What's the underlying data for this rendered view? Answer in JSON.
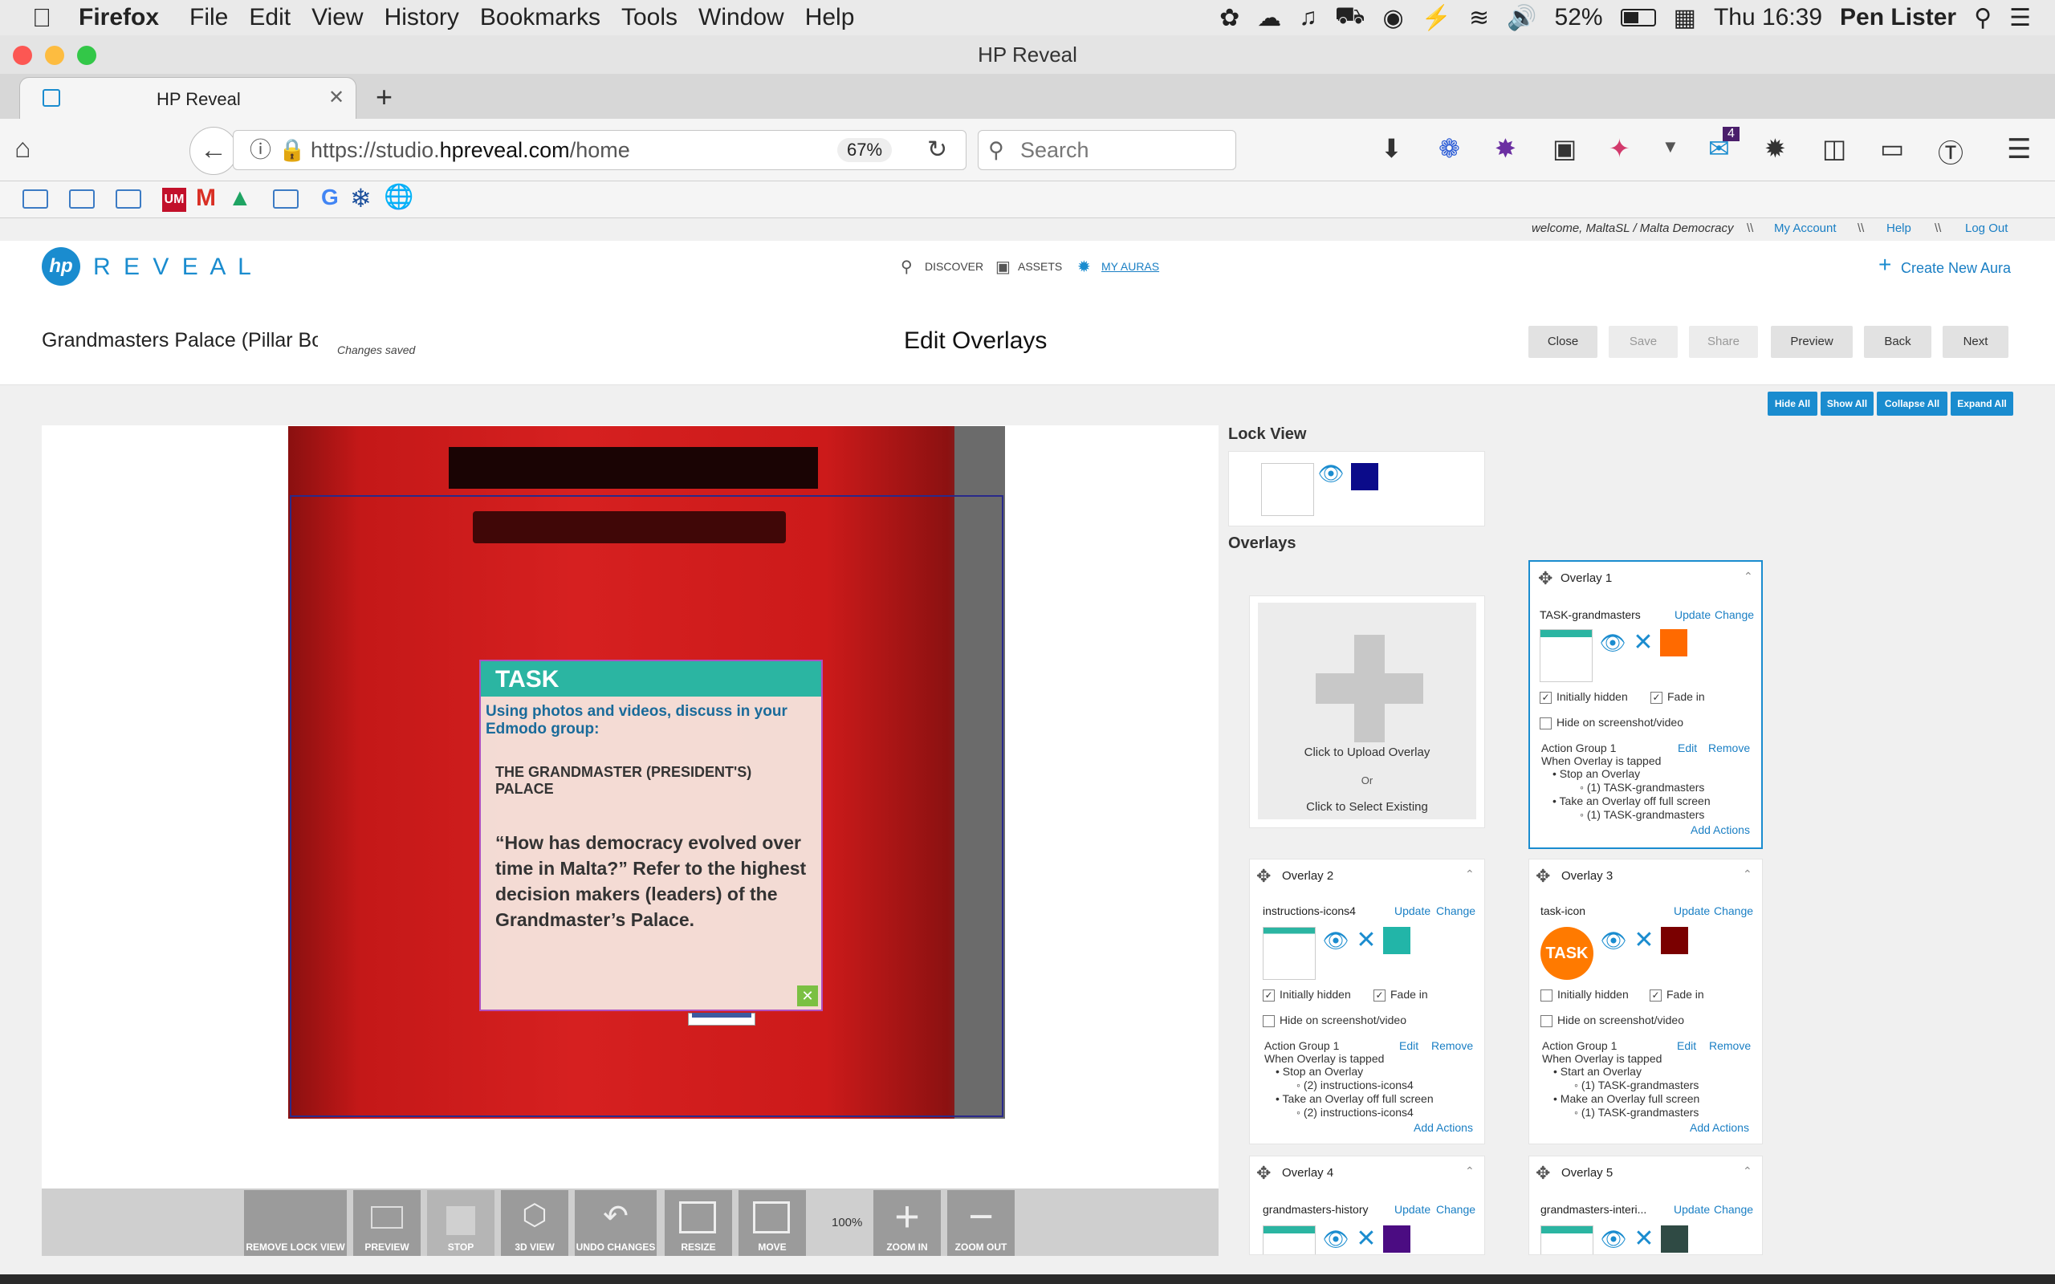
{
  "menubar": {
    "app": "Firefox",
    "items": [
      "File",
      "Edit",
      "View",
      "History",
      "Bookmarks",
      "Tools",
      "Window",
      "Help"
    ],
    "battery": "52%",
    "clock": "Thu 16:39",
    "user": "Pen Lister"
  },
  "window": {
    "title": "HP Reveal"
  },
  "tab": {
    "title": "HP Reveal"
  },
  "nav": {
    "url_prefix": "https://studio.",
    "url_domain": "hpreveal.com",
    "url_path": "/home",
    "zoom": "67%",
    "search_placeholder": "Search",
    "notif_count": "4"
  },
  "userbar": {
    "welcome": "welcome, MaltaSL / Malta Democracy",
    "sep": "\\\\",
    "my_account": "My Account",
    "help": "Help",
    "logout": "Log Out"
  },
  "header": {
    "logo_text": "R E V E A L",
    "nav": [
      "DISCOVER",
      "ASSETS",
      "MY AURAS"
    ],
    "create": "Create New Aura"
  },
  "subheader": {
    "aura_name": "Grandmasters Palace (Pillar Bo",
    "status": "Changes saved",
    "title": "Edit Overlays",
    "buttons": [
      "Close",
      "Save",
      "Share",
      "Preview",
      "Back",
      "Next"
    ]
  },
  "panel_buttons": [
    "Hide All",
    "Show All",
    "Collapse All",
    "Expand All"
  ],
  "lock_view": {
    "heading": "Lock View",
    "color": "#0b0b8a"
  },
  "overlays_heading": "Overlays",
  "upload": {
    "line1": "Click to Upload Overlay",
    "or": "Or",
    "line2": "Click to Select Existing"
  },
  "overlay_task": {
    "title": "TASK",
    "line1": "Using photos and videos, discuss in your Edmodo group:",
    "line2": "THE GRANDMASTER (PRESIDENT'S) PALACE",
    "line3": "“How has democracy evolved over time in Malta?” Refer to the highest decision makers (leaders) of the Grandmaster’s Palace."
  },
  "overlays": [
    {
      "header": "Overlay 1",
      "name": "TASK-grandmasters",
      "color": "#ff6a00",
      "initially_hidden": true,
      "fade_in": true,
      "hide_on_screenshot": false,
      "action_group": "Action Group 1",
      "trigger": "When Overlay is tapped",
      "actions": [
        {
          "action": "Stop an Overlay",
          "target": "(1) TASK-grandmasters"
        },
        {
          "action": "Take an Overlay off full screen",
          "target": "(1) TASK-grandmasters"
        }
      ]
    },
    {
      "header": "Overlay 2",
      "name": "instructions-icons4",
      "color": "#22b5a8",
      "initially_hidden": true,
      "fade_in": true,
      "hide_on_screenshot": false,
      "action_group": "Action Group 1",
      "trigger": "When Overlay is tapped",
      "actions": [
        {
          "action": "Stop an Overlay",
          "target": "(2) instructions-icons4"
        },
        {
          "action": "Take an Overlay off full screen",
          "target": "(2) instructions-icons4"
        }
      ]
    },
    {
      "header": "Overlay 3",
      "name": "task-icon",
      "color": "#7a0000",
      "thumb_text": "TASK",
      "initially_hidden": false,
      "fade_in": true,
      "hide_on_screenshot": false,
      "action_group": "Action Group 1",
      "trigger": "When Overlay is tapped",
      "actions": [
        {
          "action": "Start an Overlay",
          "target": "(1) TASK-grandmasters"
        },
        {
          "action": "Make an Overlay full screen",
          "target": "(1) TASK-grandmasters"
        }
      ]
    },
    {
      "header": "Overlay 4",
      "name": "grandmasters-history",
      "color": "#4b0c82"
    },
    {
      "header": "Overlay 5",
      "name": "grandmasters-interi...",
      "color": "#2f4a44"
    }
  ],
  "labels": {
    "update": "Update",
    "change": "Change",
    "initially_hidden": "Initially hidden",
    "fade_in": "Fade in",
    "hide_on_screenshot": "Hide on screenshot/video",
    "edit": "Edit",
    "remove": "Remove",
    "add_actions": "Add Actions"
  },
  "toolbar": {
    "tools": [
      "REMOVE LOCK VIEW",
      "PREVIEW",
      "STOP",
      "3D VIEW",
      "UNDO CHANGES",
      "RESIZE",
      "MOVE"
    ],
    "zoom": "100%",
    "zoom_in": "ZOOM IN",
    "zoom_out": "ZOOM OUT"
  }
}
